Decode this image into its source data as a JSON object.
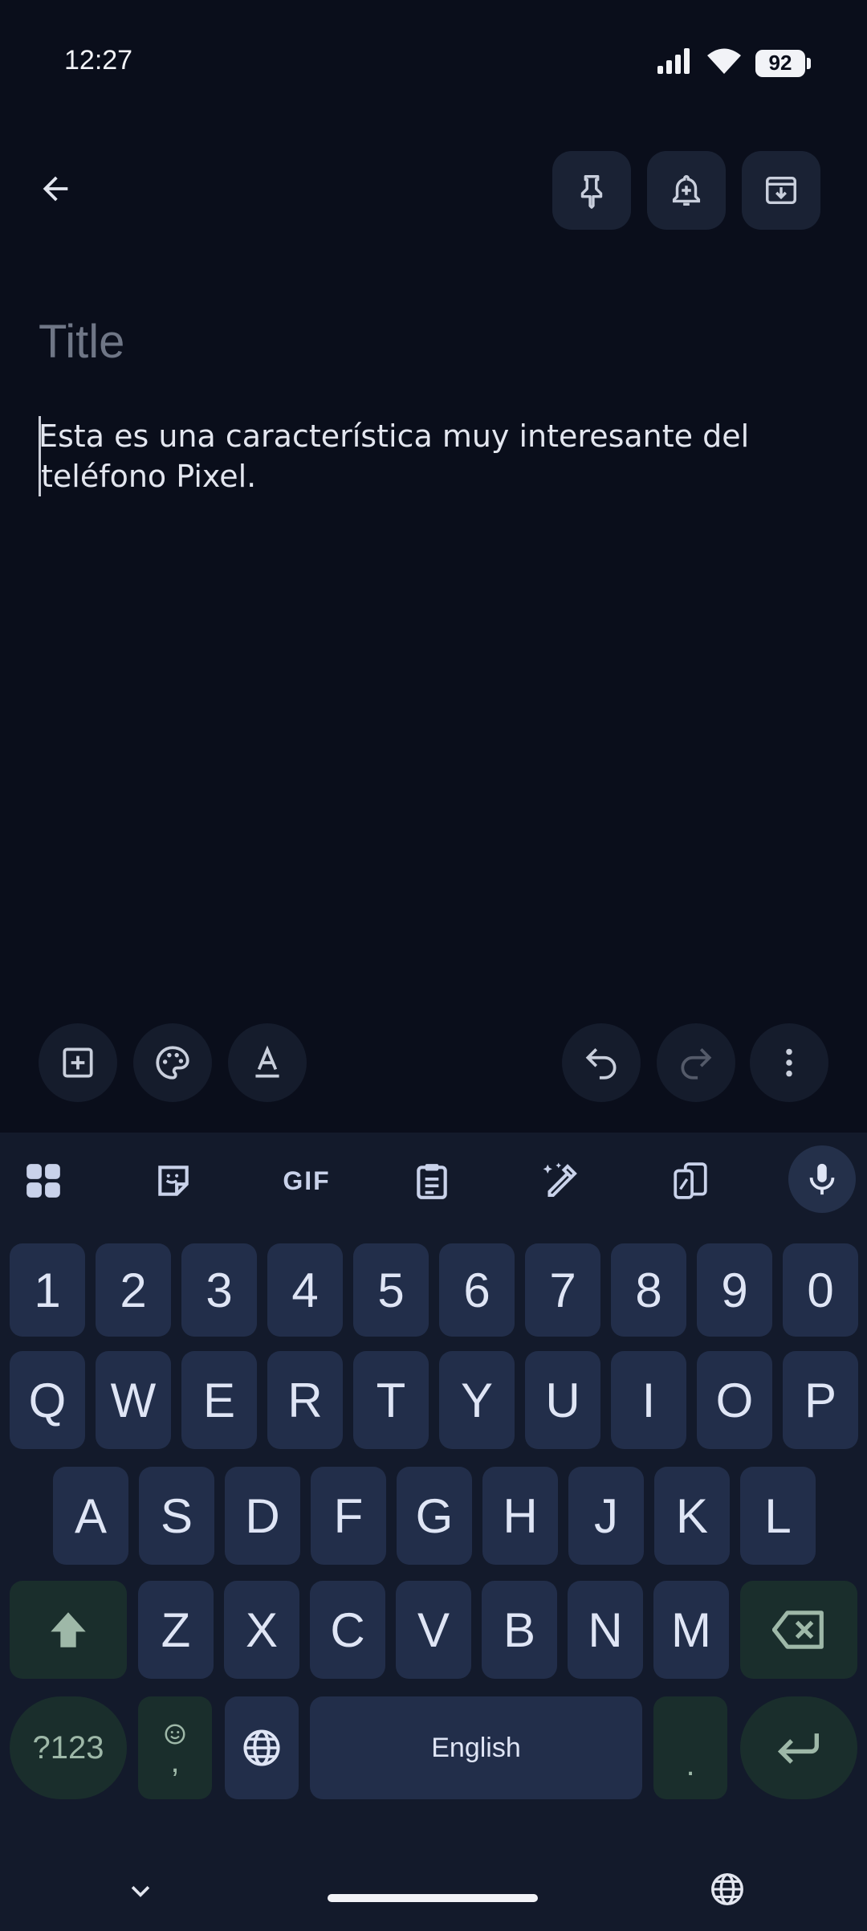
{
  "status_bar": {
    "time": "12:27",
    "battery": "92"
  },
  "note": {
    "title_placeholder": "Title",
    "body": "Esta es una característica muy interesante del teléfono Pixel."
  },
  "keyboard": {
    "number_row": [
      "1",
      "2",
      "3",
      "4",
      "5",
      "6",
      "7",
      "8",
      "9",
      "0"
    ],
    "row1": [
      "Q",
      "W",
      "E",
      "R",
      "T",
      "Y",
      "U",
      "I",
      "O",
      "P"
    ],
    "row2": [
      "A",
      "S",
      "D",
      "F",
      "G",
      "H",
      "J",
      "K",
      "L"
    ],
    "row3": [
      "Z",
      "X",
      "C",
      "V",
      "B",
      "N",
      "M"
    ],
    "symbols_label": "?123",
    "comma_label": ",",
    "space_label": "English",
    "period_label": ".",
    "gif_label": "GIF"
  },
  "colors": {
    "background": "#0a0e1b",
    "keyboard_bg": "#131a2b",
    "key_bg": "#222e4a",
    "function_key_bg": "#1a2e2c"
  }
}
